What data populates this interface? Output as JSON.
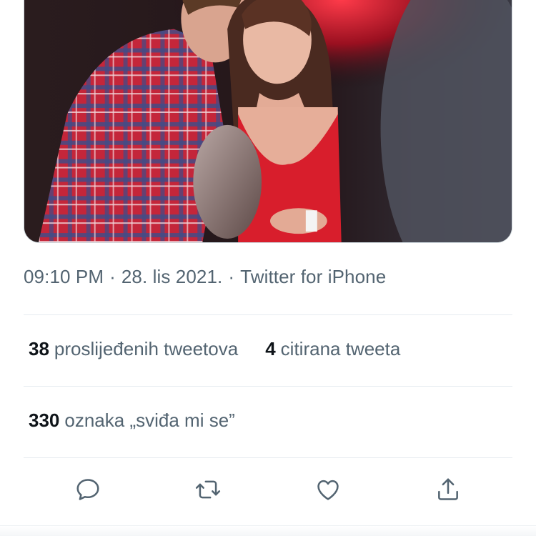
{
  "tweet": {
    "time": "09:10 PM",
    "date": "28. lis 2021.",
    "separator": "·",
    "source": "Twitter for iPhone"
  },
  "stats": {
    "retweets": {
      "count": "38",
      "label": "proslijeđenih tweetova"
    },
    "quotes": {
      "count": "4",
      "label": "citirana tweeta"
    },
    "likes": {
      "count": "330",
      "label": "oznaka „sviđa mi se”"
    }
  },
  "actions": {
    "reply_icon": "reply-icon",
    "retweet_icon": "retweet-icon",
    "like_icon": "heart-icon",
    "share_icon": "share-icon"
  },
  "colors": {
    "text_primary": "#0f1419",
    "text_secondary": "#536471",
    "divider": "#e6ecf0",
    "icon": "#536471"
  }
}
